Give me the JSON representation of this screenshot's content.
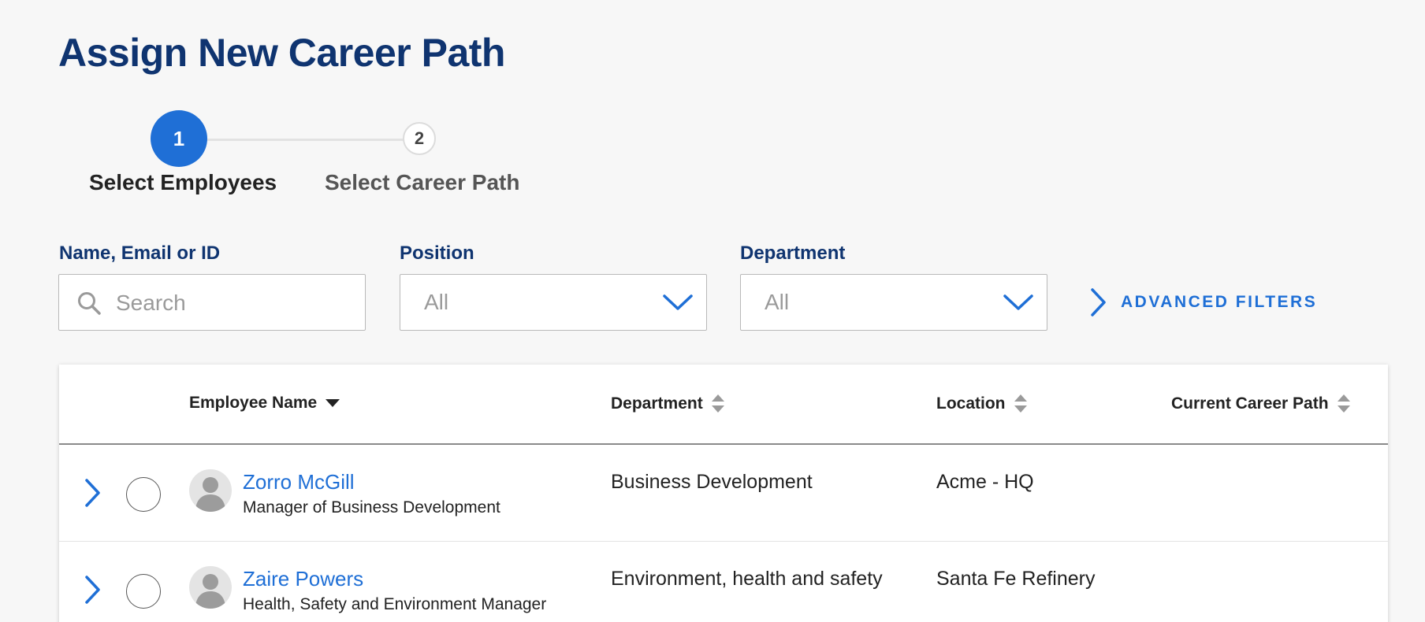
{
  "page": {
    "title": "Assign New Career Path"
  },
  "stepper": {
    "steps": [
      {
        "number": "1",
        "label": "Select Employees",
        "active": true
      },
      {
        "number": "2",
        "label": "Select Career Path",
        "active": false
      }
    ]
  },
  "filters": {
    "search": {
      "label": "Name, Email or ID",
      "placeholder": "Search",
      "value": ""
    },
    "position": {
      "label": "Position",
      "value": "All"
    },
    "department": {
      "label": "Department",
      "value": "All"
    },
    "advanced_label": "ADVANCED FILTERS"
  },
  "table": {
    "columns": {
      "employee_name": "Employee Name",
      "department": "Department",
      "location": "Location",
      "current_career_path": "Current Career Path"
    },
    "rows": [
      {
        "name": "Zorro McGill",
        "title": "Manager of Business Development",
        "department": "Business Development",
        "location": "Acme - HQ",
        "career_path": ""
      },
      {
        "name": "Zaire Powers",
        "title": "Health, Safety and Environment Manager",
        "department": "Environment, health and safety",
        "location": "Santa Fe Refinery",
        "career_path": ""
      }
    ]
  },
  "colors": {
    "brand_navy": "#0f3470",
    "accent_blue": "#1f6fd6",
    "background": "#f7f7f7"
  }
}
